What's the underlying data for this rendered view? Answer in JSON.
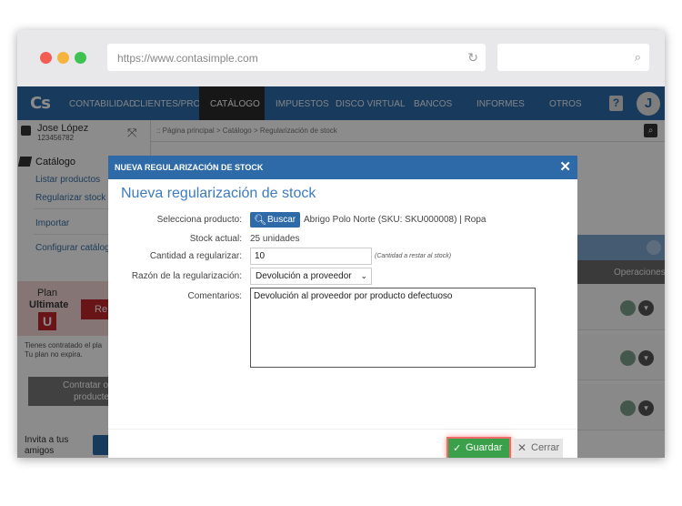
{
  "browser": {
    "url": "https://www.contasimple.com",
    "reload_icon": "reload-icon",
    "search_icon": "search-icon"
  },
  "nav": {
    "logo": "Cs",
    "items": [
      "CONTABILIDAD",
      "CLIENTES/PROV.",
      "CATÁLOGO",
      "IMPUESTOS",
      "DISCO VIRTUAL",
      "BANCOS",
      "INFORMES",
      "OTROS"
    ],
    "active": "CATÁLOGO",
    "help": "?",
    "avatar": "J"
  },
  "sidebar": {
    "user_name": "Jose López",
    "user_id": "123456782",
    "section": "Catálogo",
    "items": [
      "Listar productos",
      "Regularizar stock",
      "Importar",
      "Configurar catálog"
    ],
    "plan_label": "Plan",
    "plan_name": "Ultimate",
    "plan_badge": "U",
    "renew_label": "Re",
    "plan_info_1": "Tienes contratado el pla",
    "plan_info_2": "Tu plan no expira.",
    "contract_1": "Contratar o",
    "contract_2": "producte",
    "invite_1": "Invita a tus",
    "invite_2": "amigos"
  },
  "main": {
    "breadcrumb": ":: Página principal > Catálogo > Regularización de stock",
    "column_operations": "Operaciones"
  },
  "modal": {
    "header": "NUEVA REGULARIZACIÓN DE STOCK",
    "title": "Nueva regularización de stock",
    "label_product": "Selecciona producto:",
    "buscar": "Buscar",
    "product_value": "Abrigo Polo Norte (SKU: SKU000008) | Ropa",
    "label_stock": "Stock actual:",
    "stock_value": "25 unidades",
    "label_qty": "Cantidad a regularizar:",
    "qty_value": "10",
    "qty_hint": "(Cantidad a restar al stock)",
    "label_reason": "Razón de la regularización:",
    "reason_value": "Devolución a proveedor",
    "label_comments": "Comentarios:",
    "comments_value": "Devolución al proveedor por producto defectuoso",
    "save_label": "Guardar",
    "close_label": "Cerrar"
  },
  "colors": {
    "nav_bg": "#2c6aa8",
    "modal_header": "#2e6aa8",
    "save_green": "#3aa049",
    "highlight": "#f06a6a"
  }
}
